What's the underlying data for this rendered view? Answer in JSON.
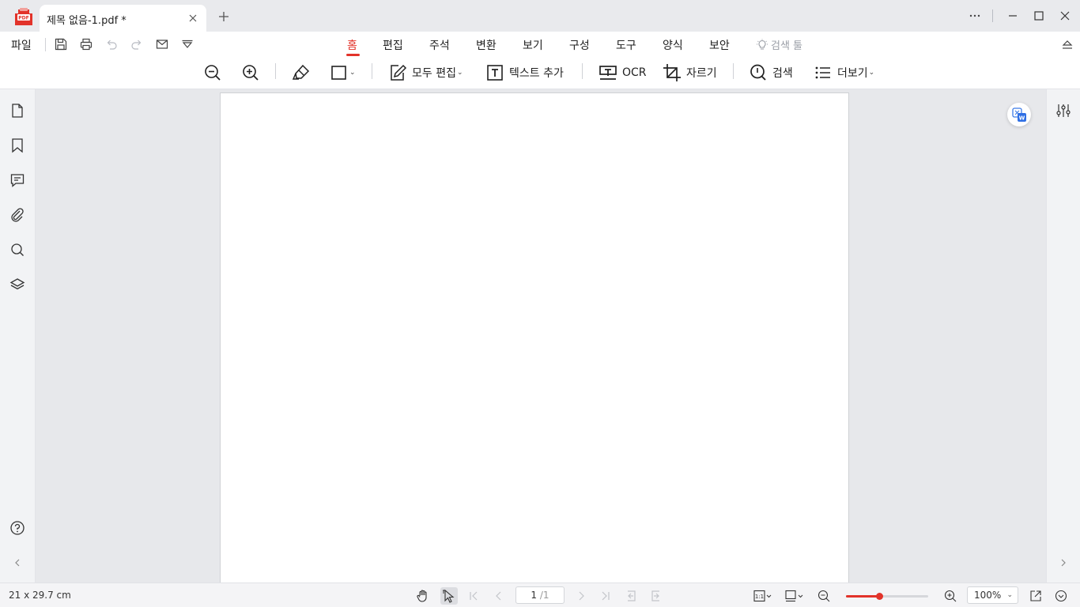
{
  "window": {
    "tab_title": "제목 없음-1.pdf *"
  },
  "menubar": {
    "file_label": "파일",
    "tabs": [
      {
        "label": "홈",
        "active": true
      },
      {
        "label": "편집"
      },
      {
        "label": "주석"
      },
      {
        "label": "변환"
      },
      {
        "label": "보기"
      },
      {
        "label": "구성"
      },
      {
        "label": "도구"
      },
      {
        "label": "양식"
      },
      {
        "label": "보안"
      }
    ],
    "search_tool_label": "검색 툴"
  },
  "toolbar": {
    "edit_all_label": "모두 편집",
    "add_text_label": "텍스트 추가",
    "ocr_label": "OCR",
    "crop_label": "자르기",
    "search_label": "검색",
    "more_label": "더보기"
  },
  "statusbar": {
    "page_size": "21 x 29.7 cm",
    "page_current": "1",
    "page_total": "/1",
    "zoom_value": "100%",
    "zoom_level": 0.4
  },
  "colors": {
    "accent": "#e2332a",
    "logo": "#e2332a"
  }
}
